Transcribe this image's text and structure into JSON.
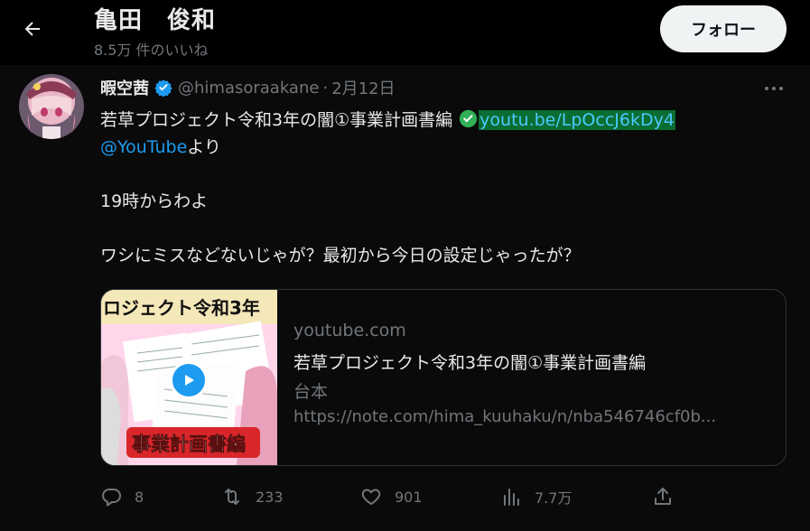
{
  "header": {
    "back_icon": "arrow-left-icon",
    "profile_name": "亀田　俊和",
    "likes_count": "8.5万 件のいいね",
    "follow_label": "フォロー"
  },
  "tweet": {
    "display_name": "暇空茜",
    "verified_icon": "verified-badge-icon",
    "handle": "@himasoraakane",
    "separator": "·",
    "date": "2月12日",
    "more_icon": "more-dots-icon",
    "text": {
      "line1_prefix": "若草プロジェクト令和3年の闇①事業計画書編 ",
      "check_emoji": "check-mark-emoji",
      "link": "youtu.be/LpOccJ6kDy4",
      "mention": "@YouTube",
      "mention_suffix": "より",
      "line2": "19時からわよ",
      "line3": "ワシにミスなどないじゃが？最初から今日の設定じゃったが？"
    },
    "card": {
      "thumb_text": "ロジェクト令和3年",
      "thumb_badge": "事業計画書編",
      "domain": "youtube.com",
      "title": "若草プロジェクト令和3年の闇①事業計画書編",
      "description": "台本",
      "url": "https://note.com/hima_kuuhaku/n/nba546746cf0b..."
    },
    "actions": {
      "reply_count": "8",
      "retweet_count": "233",
      "like_count": "901",
      "views_count": "7.7万"
    }
  },
  "colors": {
    "background": "#000000",
    "accent": "#1d9bf0",
    "link_highlight": "#0a6d31",
    "muted": "#71767b",
    "text": "#e7e9ea"
  }
}
